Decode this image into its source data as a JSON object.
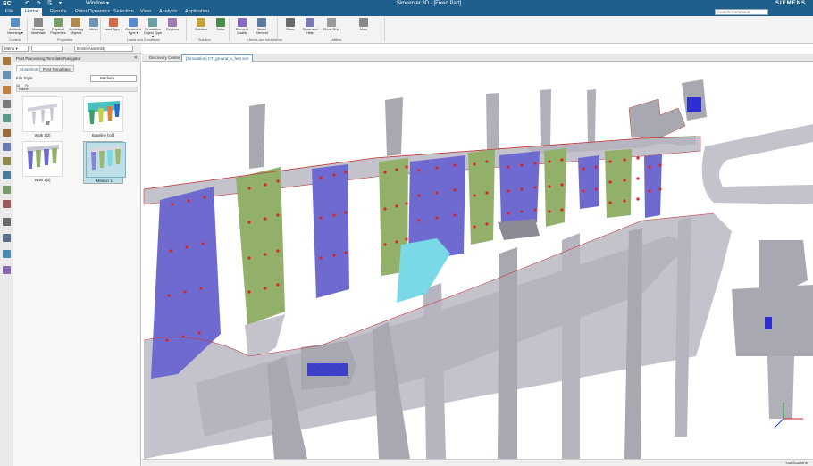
{
  "titlebar": {
    "logo": "SC",
    "window_menu": "Window ▾",
    "title": "Simcenter 3D - [Fixed Part]",
    "brand": "SIEMENS"
  },
  "ribbon_tabs": [
    "File",
    "Home",
    "Results",
    "Rotor Dynamics",
    "Selection",
    "View",
    "Analysis",
    "Application"
  ],
  "active_tab": "Home",
  "search_placeholder": "Search Command",
  "ribbon": {
    "buttons": [
      {
        "label": "Activate Meshing ▾",
        "color": "#5b8fc0"
      },
      {
        "label": "Manage Materials",
        "color": "#8a8a8a"
      },
      {
        "label": "Physical Properties",
        "color": "#7a9a6a"
      },
      {
        "label": "Modeling Objects",
        "color": "#b08a4a"
      },
      {
        "label": "Mesh",
        "color": "#6f93b5"
      },
      {
        "label": "Load Type ▾",
        "color": "#d06a4a"
      },
      {
        "label": "Constraint Type ▾",
        "color": "#5a8ad0"
      },
      {
        "label": "Simulation Object Type ▾",
        "color": "#6aa0a0"
      },
      {
        "label": "Regions",
        "color": "#a07ab0"
      },
      {
        "label": "Solution",
        "color": "#c0a040"
      },
      {
        "label": "Solve",
        "color": "#4a8a4a"
      },
      {
        "label": "Element Quality",
        "color": "#8a6ac0"
      },
      {
        "label": "Model Element",
        "color": "#5a7aa0"
      },
      {
        "label": "Show",
        "color": "#6a6a6a"
      },
      {
        "label": "Show and Hide",
        "color": "#7a7ab0"
      },
      {
        "label": "Show Only",
        "color": "#9a9a9a"
      },
      {
        "label": "More",
        "color": "#888888"
      }
    ],
    "groups": [
      "Context",
      "Properties",
      "Loads and Conditions",
      "Solution",
      "Checks and Information",
      "Utilities"
    ]
  },
  "selection_bar": {
    "menu_label": "Menu ▾",
    "filter_value": "",
    "scope_value": "Entire Assembly"
  },
  "navigator": {
    "title": "Post Processing Template Navigator",
    "tabs": [
      "Snapshots",
      "Post Templates"
    ],
    "active_tab": "Snapshots",
    "file_style_label": "File Style",
    "file_style_value": "Medium",
    "column_header": "Name",
    "thumbnails": [
      {
        "label": "Work 1[2]",
        "selected": false
      },
      {
        "label": "Baseline hold",
        "selected": false
      },
      {
        "label": "Work 1[1]",
        "selected": false
      },
      {
        "label": "Mission 1",
        "selected": true
      }
    ]
  },
  "doc_tabs": [
    {
      "label": "Discovery Center",
      "active": false
    },
    {
      "label": "[Simulation] CT_ground_v_fem.sim",
      "active": true
    }
  ],
  "status": {
    "notification": "Notifications"
  },
  "colors": {
    "title_bar": "#1f5f8b",
    "model_gray": "#a8a8b0",
    "model_gray_light": "#c4c3cc",
    "blade_purple": "#6f6ad0",
    "blade_green": "#93b06a",
    "blade_cyan": "#7ad9e6",
    "load_arrows": "#d72525",
    "mesh_edge": "#c43a3a",
    "bearing_blue": "#2e2fd0"
  }
}
